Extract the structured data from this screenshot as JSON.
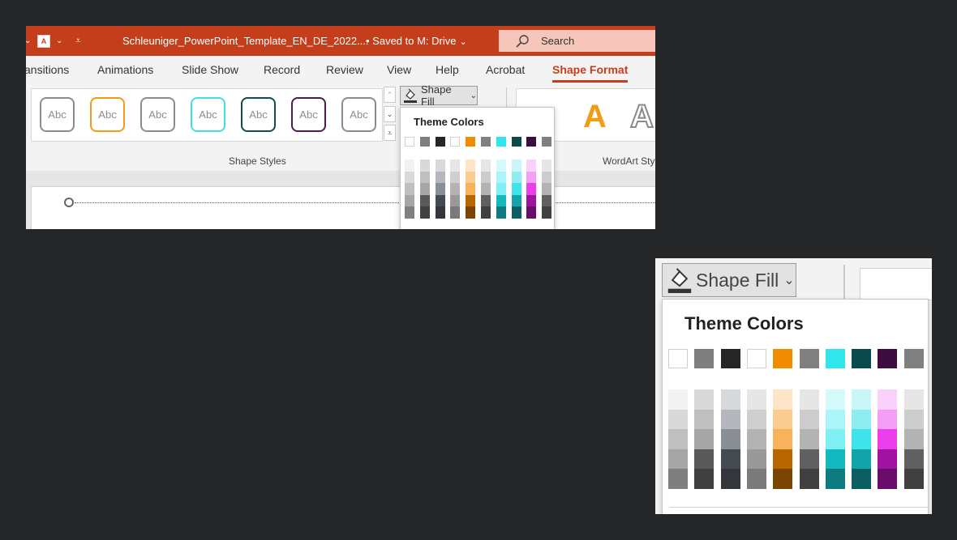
{
  "titlebar": {
    "qat_doc_glyph": "A",
    "document_title": "Schleuniger_PowerPoint_Template_EN_DE_2022....",
    "save_status": "• Saved to M: Drive",
    "search_label": "Search"
  },
  "tabs": [
    "ansitions",
    "Animations",
    "Slide Show",
    "Record",
    "Review",
    "View",
    "Help",
    "Acrobat",
    "Shape Format"
  ],
  "active_tab": "Shape Format",
  "shape_styles": {
    "group_label": "Shape Styles",
    "presets": [
      {
        "label": "Abc",
        "border": "#8c8c8c"
      },
      {
        "label": "Abc",
        "border": "#f59a13"
      },
      {
        "label": "Abc",
        "border": "#8c8c8c"
      },
      {
        "label": "Abc",
        "border": "#3ee0e0"
      },
      {
        "label": "Abc",
        "border": "#0f4d4f"
      },
      {
        "label": "Abc",
        "border": "#4f1a4f"
      },
      {
        "label": "Abc",
        "border": "#8c8c8c"
      }
    ]
  },
  "shape_fill": {
    "label": "Shape Fill",
    "dropdown_title": "Theme Colors"
  },
  "wordart": {
    "group_label": "WordArt Sty",
    "sample_letter_1": "A",
    "sample_letter_2": "A"
  },
  "colors": {
    "accent": "#c43e1c",
    "theme_row": [
      "#ffffff",
      "#7f7f7f",
      "#262626",
      "#ffffff",
      "#f08c00",
      "#808080",
      "#2ee6ec",
      "#0b4a4c",
      "#3e0d40",
      "#808080"
    ],
    "shades": [
      [
        "#f2f2f2",
        "#d9d9d9",
        "#bfbfbf",
        "#a6a6a6",
        "#7f7f7f"
      ],
      [
        "#d9d9d9",
        "#bfbfbf",
        "#a6a6a6",
        "#595959",
        "#404040"
      ],
      [
        "#d6d9dc",
        "#b4b8bd",
        "#8a8f96",
        "#454a50",
        "#33373b"
      ],
      [
        "#e6e6e6",
        "#cfcfcf",
        "#b3b3b3",
        "#999999",
        "#7a7a7a"
      ],
      [
        "#fde6c7",
        "#fbcc8f",
        "#f8b35a",
        "#b86700",
        "#7a4500"
      ],
      [
        "#e6e6e6",
        "#cccccc",
        "#b3b3b3",
        "#606060",
        "#404040"
      ],
      [
        "#d4fafb",
        "#a9f5f7",
        "#7ef0f3",
        "#13b9bf",
        "#0d7b7f"
      ],
      [
        "#c9f6f7",
        "#8fedf0",
        "#3ee4e9",
        "#13a4a9",
        "#0b5f62"
      ],
      [
        "#fbd0fb",
        "#f59ef5",
        "#ec3fec",
        "#a012a0",
        "#6a0c6a"
      ],
      [
        "#e6e6e6",
        "#cccccc",
        "#b3b3b3",
        "#606060",
        "#404040"
      ]
    ]
  }
}
